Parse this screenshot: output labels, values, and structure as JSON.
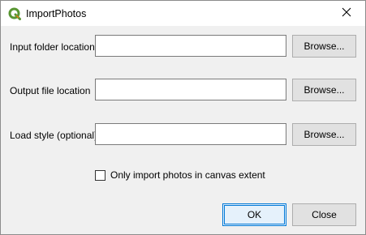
{
  "window": {
    "title": "ImportPhotos",
    "app_icon": "qgis-logo-icon",
    "close_icon": "close-icon"
  },
  "form": {
    "input_folder": {
      "label": "Input folder location",
      "value": "",
      "browse_label": "Browse..."
    },
    "output_file": {
      "label": "Output file location",
      "value": "",
      "browse_label": "Browse..."
    },
    "load_style": {
      "label": "Load style (optional)",
      "value": "",
      "browse_label": "Browse..."
    },
    "canvas_extent_checkbox": {
      "label": "Only import photos in canvas extent",
      "checked": false
    }
  },
  "buttons": {
    "ok_label": "OK",
    "close_label": "Close"
  },
  "colors": {
    "qgis_green": "#589632",
    "qgis_yellow": "#ee7913",
    "focus_blue": "#0078d7"
  }
}
